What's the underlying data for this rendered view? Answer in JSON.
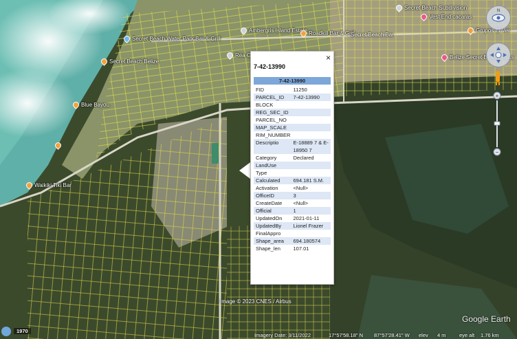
{
  "map": {
    "pois": [
      {
        "id": "secret-beach-subdivision",
        "label": "Secret Beach Subdivision",
        "color": "#e0e0e0"
      },
      {
        "id": "ambergris-island-estate",
        "label": "Ambergris Island Estate",
        "color": "#e0e0e0"
      },
      {
        "id": "roadkill-bar",
        "label": "Roadkill Bar & Grill",
        "color": "#f4a13d"
      },
      {
        "id": "secret-beach-bar",
        "label": "Secret Beach Bar",
        "color": "#f4a13d"
      },
      {
        "id": "vest-end-cacaras",
        "label": "Vest End cacaras",
        "color": "#e85a8c"
      },
      {
        "id": "grupos-el-ver",
        "label": "Grupos El Ver",
        "color": "#f4a13d"
      },
      {
        "id": "secret-beach-water-park",
        "label": "Secret Beach Water Park Bar & Grill",
        "color": "#6fb8f0"
      },
      {
        "id": "secret-beach-belize",
        "label": "Secret Beach Belize",
        "color": "#f4a13d"
      },
      {
        "id": "rea-ca",
        "label": "Rea Ca",
        "color": "#e0e0e0"
      },
      {
        "id": "belize-secret-beach-villas",
        "label": "Belize Secret Beach Villas",
        "color": "#e85a8c"
      },
      {
        "id": "blue-bayou",
        "label": "Blue Bayou",
        "color": "#f4a13d"
      },
      {
        "id": "waikiki-tiki-bar",
        "label": "Waikiki Tiki Bar",
        "color": "#f4a13d"
      }
    ],
    "attribution": "Image © 2023 CNES / Airbus",
    "logo": "Google Earth"
  },
  "popup": {
    "title": "7-42-13990",
    "header": "7-42-13990",
    "rows": [
      {
        "key": "FID",
        "value": "11250"
      },
      {
        "key": "PARCEL_ID",
        "value": "7-42-13990"
      },
      {
        "key": "BLOCK",
        "value": ""
      },
      {
        "key": "REG_SEC_ID",
        "value": ""
      },
      {
        "key": "PARCEL_NO",
        "value": ""
      },
      {
        "key": "MAP_SCALE",
        "value": ""
      },
      {
        "key": "RIM_NUMBER",
        "value": ""
      },
      {
        "key": "Descriptio",
        "value": "E-18889 7 & E-18950 7"
      },
      {
        "key": "Category",
        "value": "Declared"
      },
      {
        "key": "LandUse",
        "value": ""
      },
      {
        "key": "Type",
        "value": ""
      },
      {
        "key": "Calculated",
        "value": "694.181 S.M."
      },
      {
        "key": "Activation",
        "value": "<Null>"
      },
      {
        "key": "OfficeID",
        "value": "3"
      },
      {
        "key": "CreateDate",
        "value": "<Null>"
      },
      {
        "key": "Official",
        "value": "1"
      },
      {
        "key": "UpdatedOn",
        "value": "2021-01-11"
      },
      {
        "key": "UpdatedBy",
        "value": "Lionel Frazer"
      },
      {
        "key": "FinalAppro",
        "value": ""
      },
      {
        "key": "Shape_area",
        "value": "694.180574"
      },
      {
        "key": "Shape_len",
        "value": "107.01"
      }
    ],
    "close": "×"
  },
  "statusbar": {
    "year": "1970",
    "imagery_date": "Imagery Date: 3/11/2022",
    "lat": "17°57'58.18\" N",
    "lon": "87°57'28.41\" W",
    "elev_label": "elev",
    "elev_value": "4 m",
    "eye_alt": "eye alt",
    "eye_alt_value": "1.76 km"
  }
}
